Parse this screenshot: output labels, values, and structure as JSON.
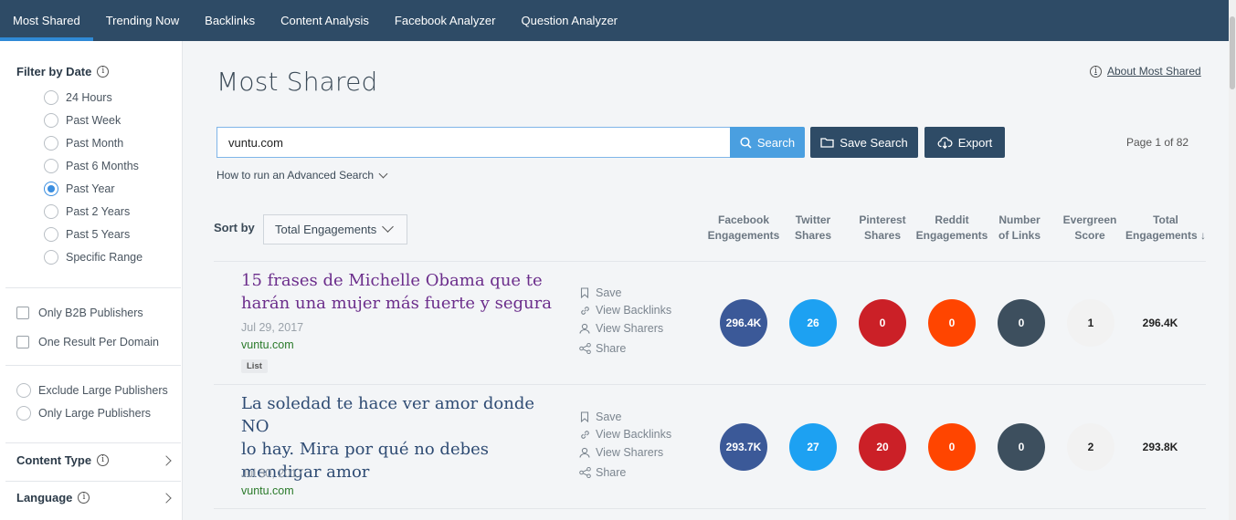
{
  "nav": {
    "tabs": [
      {
        "label": "Most Shared"
      },
      {
        "label": "Trending Now"
      },
      {
        "label": "Backlinks"
      },
      {
        "label": "Content Analysis"
      },
      {
        "label": "Facebook Analyzer"
      },
      {
        "label": "Question Analyzer"
      }
    ],
    "active_tab": "Most Shared"
  },
  "sidebar": {
    "filter_by_date": {
      "title": "Filter by Date",
      "options": [
        {
          "label": "24 Hours"
        },
        {
          "label": "Past Week"
        },
        {
          "label": "Past Month"
        },
        {
          "label": "Past 6 Months"
        },
        {
          "label": "Past Year"
        },
        {
          "label": "Past 2 Years"
        },
        {
          "label": "Past 5 Years"
        },
        {
          "label": "Specific Range"
        }
      ],
      "selected": "Past Year"
    },
    "checkboxes": [
      {
        "label": "Only B2B Publishers"
      },
      {
        "label": "One Result Per Domain"
      }
    ],
    "publisher_size": [
      {
        "label": "Exclude Large Publishers"
      },
      {
        "label": "Only Large Publishers"
      }
    ],
    "content_type": {
      "label": "Content Type"
    },
    "language": {
      "label": "Language"
    }
  },
  "main": {
    "title": "Most Shared",
    "about_link": "About Most Shared",
    "search": {
      "value": "vuntu.com",
      "button_label": "Search"
    },
    "save_search_label": "Save Search",
    "export_label": "Export",
    "page_info": "Page 1 of 82",
    "advanced_search_label": "How to run an Advanced Search",
    "sort": {
      "label": "Sort by",
      "selected": "Total Engagements"
    },
    "columns": {
      "facebook": [
        "Facebook",
        "Engagements"
      ],
      "twitter": [
        "Twitter",
        "Shares"
      ],
      "pinterest": [
        "Pinterest",
        "Shares"
      ],
      "reddit": [
        "Reddit",
        "Engagements"
      ],
      "links": [
        "Number",
        "of Links"
      ],
      "evergreen": [
        "Evergreen",
        "Score"
      ],
      "total": [
        "Total",
        "Engagements ↓"
      ]
    },
    "actions": {
      "save": "Save",
      "view_backlinks": "View Backlinks",
      "view_sharers": "View Sharers",
      "share": "Share"
    },
    "results": [
      {
        "title_lines": [
          "15 frases de Michelle Obama que te",
          "harán una mujer más fuerte y segura"
        ],
        "date": "Jul 29, 2017",
        "domain": "vuntu.com",
        "tag": "List",
        "facebook": "296.4K",
        "twitter": "26",
        "pinterest": "0",
        "reddit": "0",
        "links": "0",
        "evergreen": "1",
        "total": "296.4K"
      },
      {
        "title_lines": [
          "La soledad te hace ver amor donde NO",
          "lo hay. Mira por qué no debes",
          "mendigar amor"
        ],
        "date": "Jul 30, 2017",
        "domain": "vuntu.com",
        "facebook": "293.7K",
        "twitter": "27",
        "pinterest": "20",
        "reddit": "0",
        "links": "0",
        "evergreen": "2",
        "total": "293.8K"
      }
    ]
  },
  "colors": {
    "nav_bg": "#2e4b66",
    "active_underline": "#2f8ad6",
    "facebook": "#3b5998",
    "twitter": "#1da1f2",
    "pinterest": "#cb2027",
    "reddit": "#ff4500",
    "links": "#3d4f5e",
    "evergreen": "#f2f2f2"
  }
}
